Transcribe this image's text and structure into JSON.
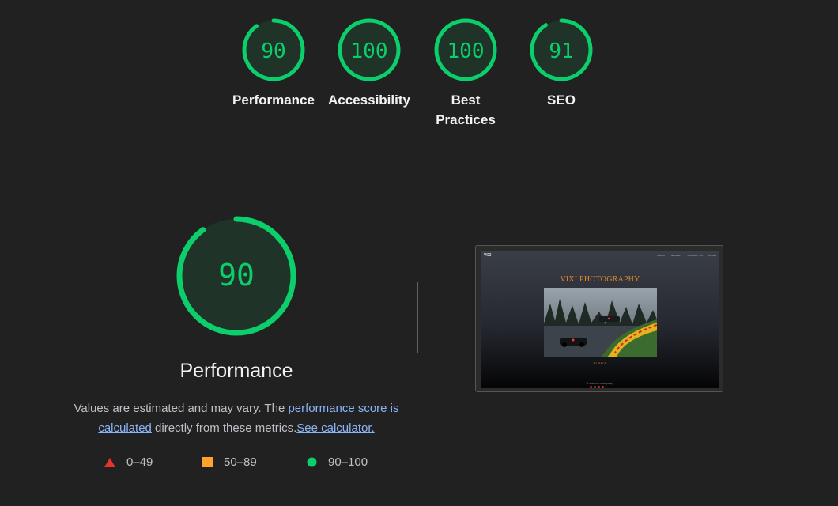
{
  "summary": {
    "categories": [
      {
        "label": "Performance",
        "score": "90",
        "value": 90
      },
      {
        "label": "Accessibility",
        "score": "100",
        "value": 100
      },
      {
        "label": "Best Practices",
        "score": "100",
        "value": 100
      },
      {
        "label": "SEO",
        "score": "91",
        "value": 91
      }
    ]
  },
  "detail": {
    "score": "90",
    "value": 90,
    "title": "Performance",
    "desc_prefix": "Values are estimated and may vary. The ",
    "link_score": "performance score is calculated",
    "desc_middle": " directly from these metrics.",
    "link_calculator": "See calculator."
  },
  "legend": [
    {
      "range": "0–49",
      "shape": "triangle",
      "color": "#e8332b"
    },
    {
      "range": "50–89",
      "shape": "square",
      "color": "#ffa32b"
    },
    {
      "range": "90–100",
      "shape": "circle",
      "color": "#0cce6b"
    }
  ],
  "colors": {
    "pass": "#0cce6b",
    "gauge_bg": "#1f3329",
    "background": "#212121"
  },
  "screenshot": {
    "logo": "VIXI",
    "nav": [
      "ABOUT",
      "GALLERY",
      "CONTACT US",
      "STORE"
    ],
    "heading": "VIXI PHOTOGRAPHY",
    "caption": "F1 RACE",
    "copyright": "© 2024 Vixi Photography"
  }
}
